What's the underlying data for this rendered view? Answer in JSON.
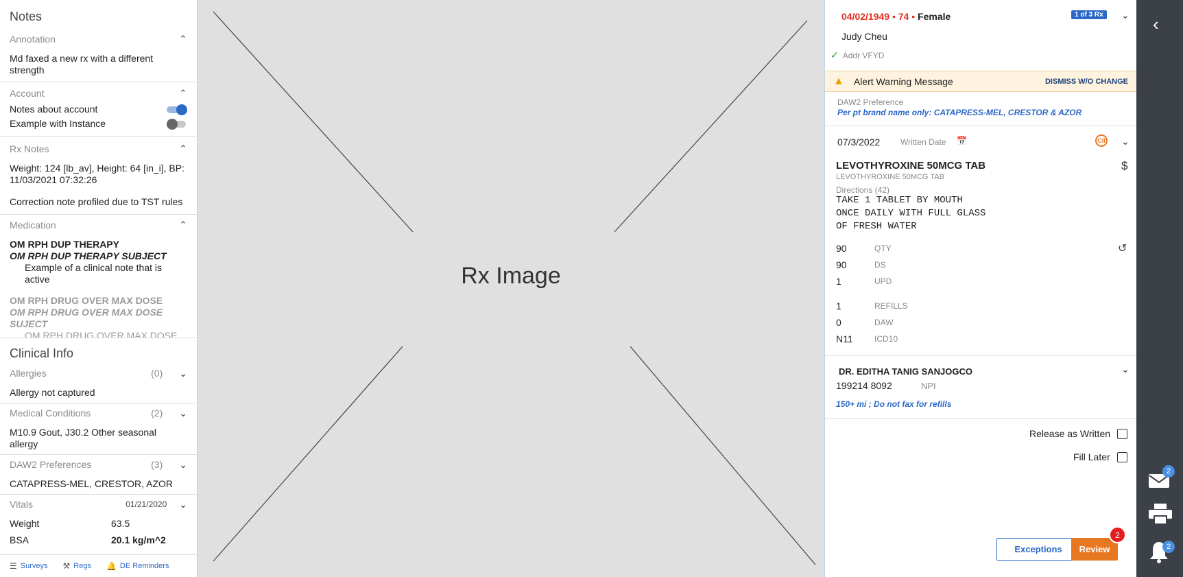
{
  "notes": {
    "title": "Notes",
    "annotation": {
      "label": "Annotation",
      "text": "Md faxed a new rx with a different strength"
    },
    "account": {
      "label": "Account",
      "items": [
        {
          "label": "Notes about account",
          "on": true
        },
        {
          "label": "Example with Instance",
          "on": false
        }
      ]
    },
    "rx_notes": {
      "label": "Rx Notes",
      "text1": "Weight: 124 [lb_av], Height: 64 [in_i], BP: 11/03/2021 07:32:26",
      "text2": "Correction note profiled due to TST rules"
    },
    "medication": {
      "label": "Medication",
      "item1_title": "OM RPH DUP THERAPY",
      "item1_subject": "OM RPH DUP THERAPY SUBJECT",
      "item1_note": "Example of a clinical note that is active",
      "item2_title": "OM RPH DRUG OVER MAX DOSE",
      "item2_subject": "OM RPH DRUG OVER MAX DOSE SUJECT",
      "item2_note": "OM RPH DRUG OVER MAX DOSE"
    }
  },
  "clinical": {
    "title": "Clinical Info",
    "allergies": {
      "label": "Allergies",
      "count": "(0)",
      "text": "Allergy not captured"
    },
    "conditions": {
      "label": "Medical Conditions",
      "count": "(2)",
      "text": "M10.9 Gout, J30.2 Other seasonal allergy"
    },
    "daw2": {
      "label": "DAW2 Preferences",
      "count": "(3)",
      "text": "CATAPRESS-MEL, CRESTOR, AZOR"
    },
    "vitals": {
      "label": "Vitals",
      "date": "01/21/2020",
      "weight_label": "Weight",
      "weight": "63.5",
      "bsa_label": "BSA",
      "bsa": "20.1 kg/m^2"
    }
  },
  "footer": {
    "surveys": "Surveys",
    "regs": "Regs",
    "reminders": "DE Reminders"
  },
  "image": {
    "label": "Rx Image"
  },
  "patient": {
    "dob": "04/02/1949",
    "age": "74",
    "sex": "Female",
    "rx_badge": "1 of 3 Rx",
    "name": "Judy Cheu",
    "addr": "Addr VFYD"
  },
  "alert": {
    "text": "Alert Warning Message",
    "dismiss": "DISMISS W/O CHANGE"
  },
  "daw2": {
    "label": "DAW2 Preference",
    "text": "Per pt brand name only: CATAPRESS-MEL, CRESTOR & AZOR"
  },
  "rx": {
    "written_date": "07/3/2022",
    "written_label": "Written Date",
    "drug": "LEVOTHYROXINE 50MCG TAB",
    "drug_sub": "LEVOTHYROXINE 50MCG TAB",
    "directions_label": "Directions (42)",
    "dir1": "TAKE 1 TABLET BY MOUTH",
    "dir2": "ONCE DAILY WITH FULL GLASS",
    "dir3": "OF FRESH WATER",
    "qty": "90",
    "qty_label": "QTY",
    "ds": "90",
    "ds_label": "DS",
    "upd": "1",
    "upd_label": "UPD",
    "refills": "1",
    "refills_label": "REFILLS",
    "daw": "0",
    "daw_label": "DAW",
    "icd": "N11",
    "icd_label": "ICD10"
  },
  "prescriber": {
    "name": "DR. EDITHA TANIG SANJOGCO",
    "npi": "199214 8092",
    "npi_label": "NPI",
    "note": "150+ mi ; Do not fax for refills"
  },
  "options": {
    "release": "Release as Written",
    "fill_later": "Fill Later"
  },
  "actions": {
    "exceptions": "Exceptions",
    "review": "Review",
    "review_count": "2"
  },
  "rail": {
    "mail_count": "2",
    "notif_count": "2"
  },
  "colors": {
    "accent": "#2c68c8",
    "alert": "#e0301e",
    "review": "#e87722",
    "rail": "#3c4148"
  }
}
